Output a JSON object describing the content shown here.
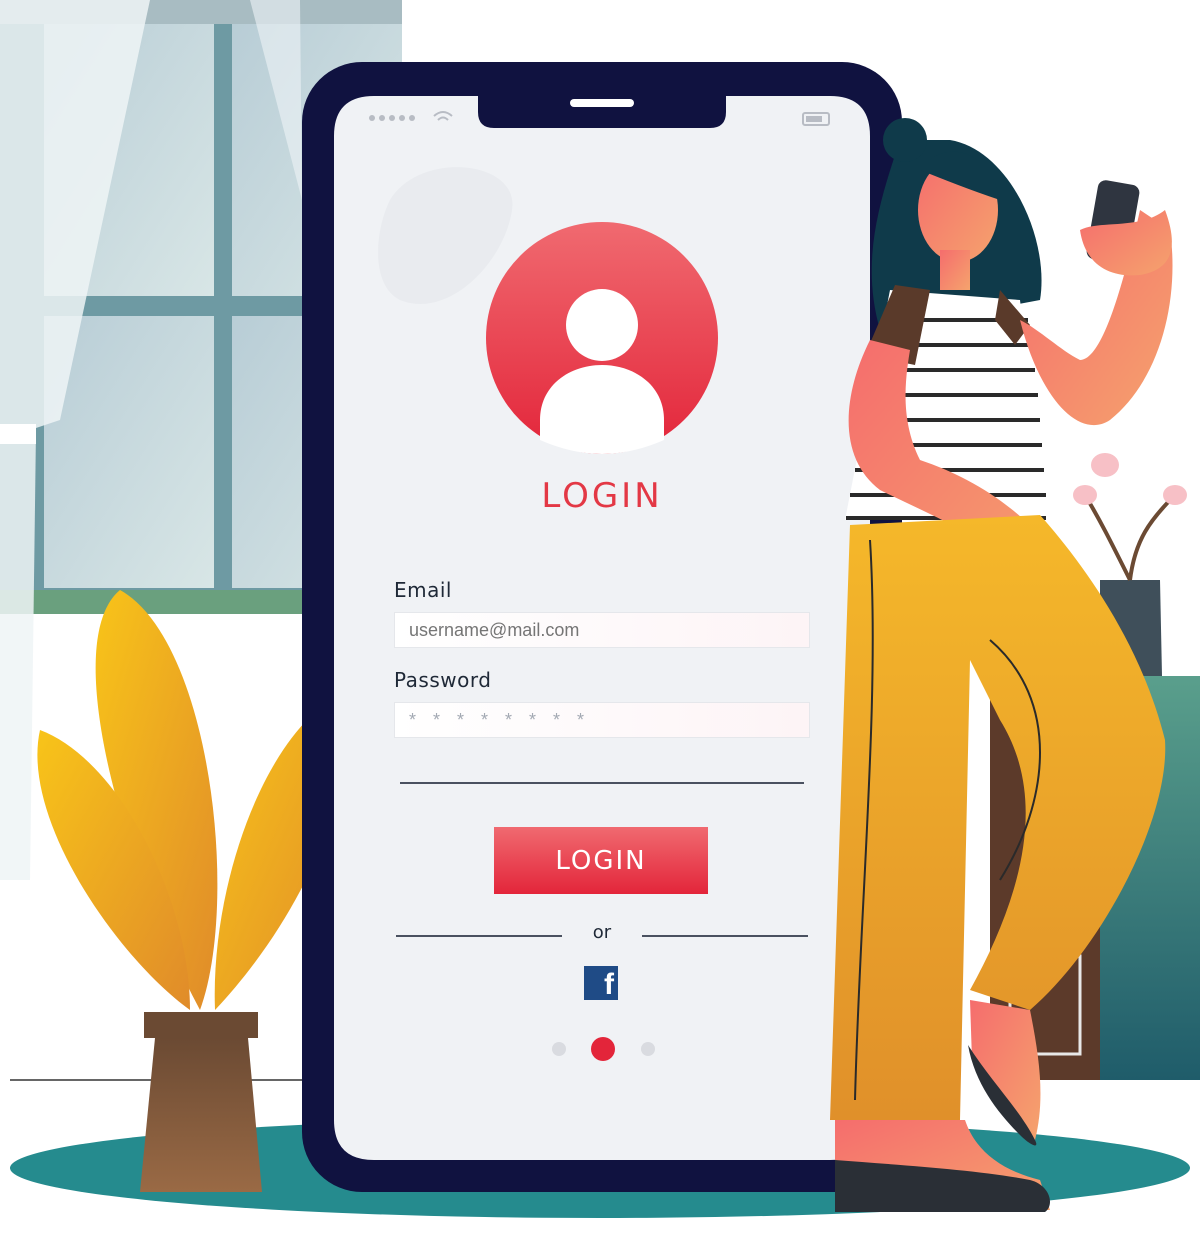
{
  "screen": {
    "title": "LOGIN",
    "email_label": "Email",
    "email_placeholder": "username@mail.com",
    "password_label": "Password",
    "password_value": "* * * * * * * *",
    "login_button": "LOGIN",
    "or_text": "or",
    "facebook_letter": "f",
    "pagination": {
      "count": 3,
      "active": 1
    }
  },
  "colors": {
    "accent": "#e33845",
    "phone_frame": "#101240",
    "facebook": "#1f4b86",
    "teal_floor": "#258b8e",
    "pants": "#eba321"
  },
  "icons": [
    "signal-dots-icon",
    "wifi-icon",
    "battery-icon",
    "user-avatar-icon",
    "facebook-icon"
  ]
}
